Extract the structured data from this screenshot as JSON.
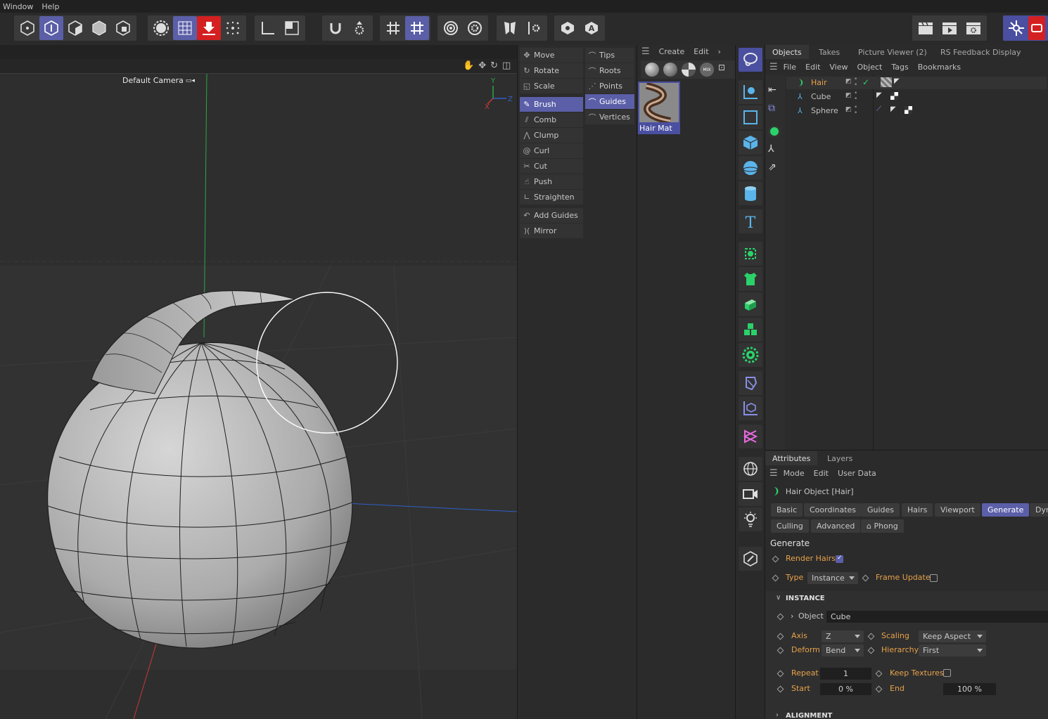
{
  "menubar": {
    "items": [
      "Window",
      "Help"
    ]
  },
  "viewport": {
    "camera_label": "Default Camera",
    "axis_labels": {
      "y": "Y",
      "z": "Z",
      "x": "X"
    }
  },
  "hair_tools": {
    "left": [
      {
        "label": "Move",
        "icon": "move-icon",
        "active": false
      },
      {
        "label": "Rotate",
        "icon": "rotate-icon",
        "active": false
      },
      {
        "label": "Scale",
        "icon": "scale-icon",
        "active": false
      },
      {
        "label": "Brush",
        "icon": "brush-icon",
        "active": true
      },
      {
        "label": "Comb",
        "icon": "comb-icon",
        "active": false
      },
      {
        "label": "Clump",
        "icon": "clump-icon",
        "active": false
      },
      {
        "label": "Curl",
        "icon": "curl-icon",
        "active": false
      },
      {
        "label": "Cut",
        "icon": "scissors-icon",
        "active": false
      },
      {
        "label": "Push",
        "icon": "push-icon",
        "active": false
      },
      {
        "label": "Straighten",
        "icon": "straighten-icon",
        "active": false
      },
      {
        "label": "Add Guides",
        "icon": "add-guides-icon",
        "active": false
      },
      {
        "label": "Mirror",
        "icon": "mirror-icon",
        "active": false
      }
    ],
    "right": [
      {
        "label": "Tips",
        "active": false
      },
      {
        "label": "Roots",
        "active": false
      },
      {
        "label": "Points",
        "active": false
      },
      {
        "label": "Guides",
        "active": true
      },
      {
        "label": "Vertices",
        "active": false
      }
    ]
  },
  "material_manager": {
    "menu": [
      "Create",
      "Edit"
    ],
    "material_name": "Hair Mat"
  },
  "objects_manager": {
    "tabs": [
      "Objects",
      "Takes",
      "Picture Viewer (2)",
      "RS Feedback Display"
    ],
    "menu": [
      "File",
      "Edit",
      "View",
      "Object",
      "Tags",
      "Bookmarks"
    ],
    "objects": [
      {
        "name": "Hair",
        "selected": true
      },
      {
        "name": "Cube",
        "selected": false
      },
      {
        "name": "Sphere",
        "selected": false
      }
    ]
  },
  "attributes": {
    "tabs": [
      "Attributes",
      "Layers"
    ],
    "menu": [
      "Mode",
      "Edit",
      "User Data"
    ],
    "object_title": "Hair Object [Hair]",
    "group_tabs_row1": [
      "Basic",
      "Coordinates",
      "Guides",
      "Hairs",
      "Viewport",
      "Generate",
      "Dyn"
    ],
    "group_tabs_row2": [
      "Culling",
      "Advanced",
      "Phong"
    ],
    "active_group": "Generate",
    "section_title": "Generate",
    "render_hairs_label": "Render Hairs",
    "render_hairs": true,
    "type_label": "Type",
    "type_value": "Instance",
    "frame_update_label": "Frame Update",
    "frame_update": false,
    "instance_header": "INSTANCE",
    "object_label": "Object",
    "object_value": "Cube",
    "axis_label": "Axis",
    "axis_value": "Z",
    "scaling_label": "Scaling",
    "scaling_value": "Keep Aspect",
    "deform_label": "Deform",
    "deform_value": "Bend",
    "hierarchy_label": "Hierarchy",
    "hierarchy_value": "First",
    "repeat_label": "Repeat",
    "repeat_value": "1",
    "keep_textures_label": "Keep Textures",
    "keep_textures": false,
    "start_label": "Start",
    "start_value": "0 %",
    "end_label": "End",
    "end_value": "100 %",
    "alignment_header": "ALIGNMENT"
  },
  "colors": {
    "accent": "#5b5fa8",
    "label_orange": "#e8a24a",
    "hair_green": "#2bd26a",
    "record_red": "#d42020"
  }
}
